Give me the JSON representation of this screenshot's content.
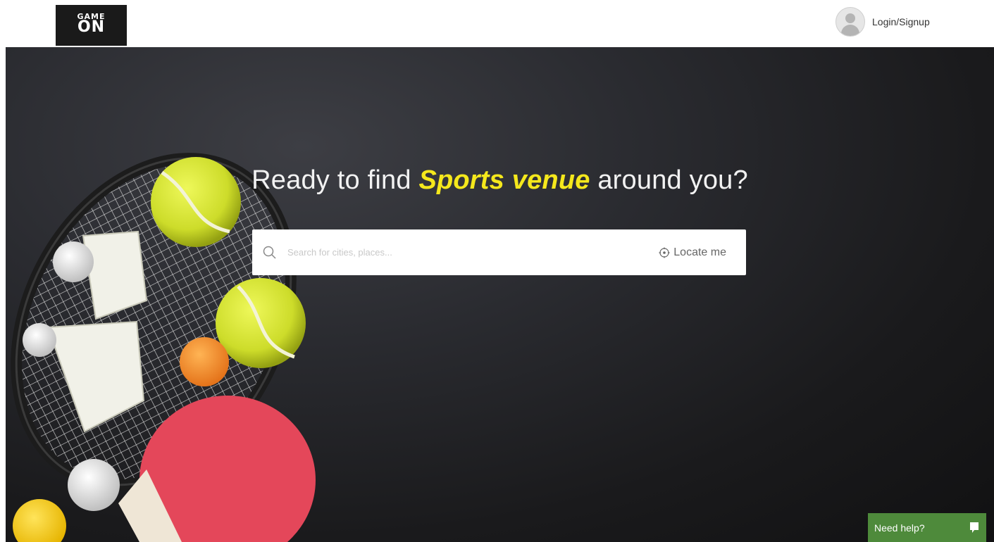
{
  "brand": {
    "logo_line1": "GAME",
    "logo_line2": "ON"
  },
  "header": {
    "login_label": "Login/Signup",
    "avatar_icon": "user-avatar-icon"
  },
  "hero": {
    "headline_before": "Ready to find ",
    "headline_highlight": "Sports venue",
    "headline_after": " around you?",
    "highlight_color": "#f5e81c"
  },
  "search": {
    "placeholder": "Search for cities, places...",
    "value": "",
    "locate_label": "Locate me",
    "search_icon": "search-icon",
    "locate_icon": "locate-icon"
  },
  "help_widget": {
    "label": "Need help?",
    "icon": "chat-icon",
    "color": "#4e8a3b"
  }
}
